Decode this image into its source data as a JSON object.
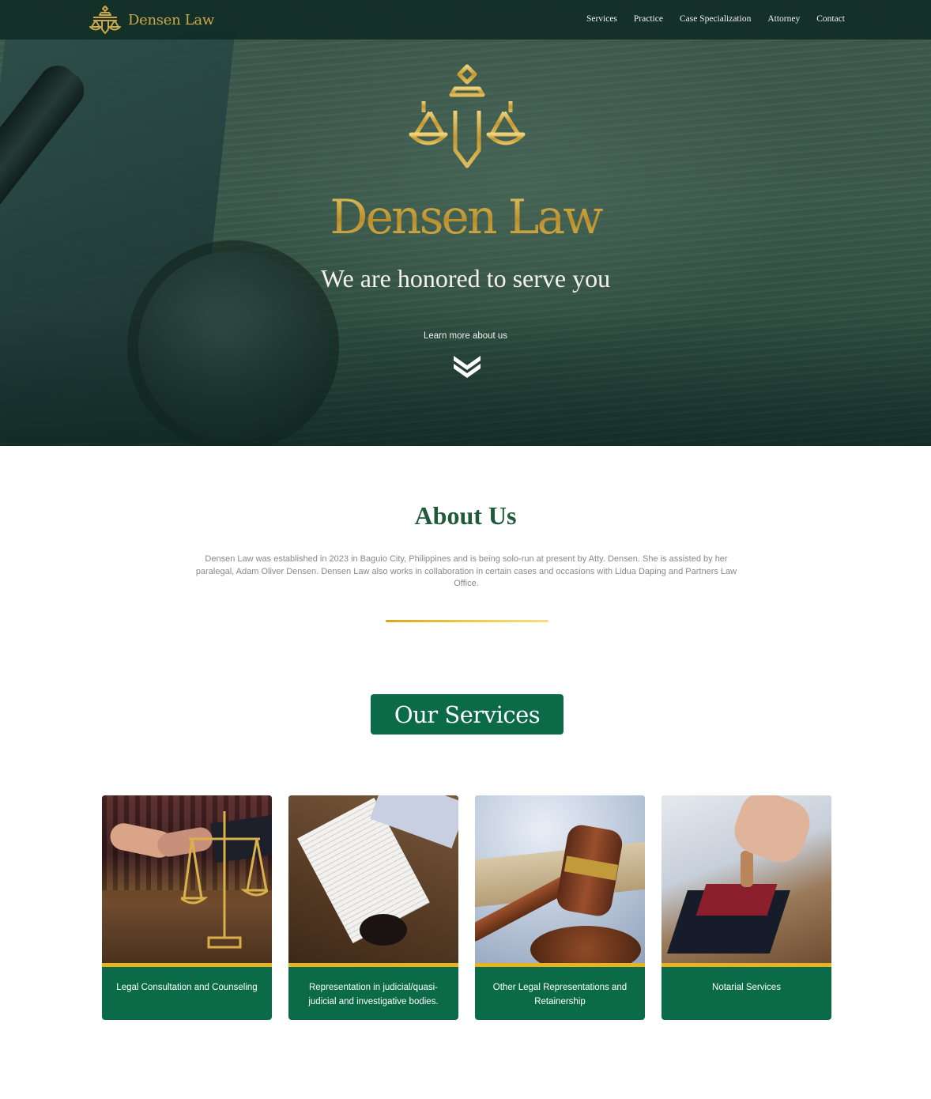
{
  "nav": {
    "brand": "Densen Law",
    "links": [
      "Services",
      "Practice",
      "Case Specialization",
      "Attorney",
      "Contact"
    ]
  },
  "hero": {
    "title": "Densen Law",
    "tagline": "We are honored to serve you",
    "learn_more": "Learn more about us"
  },
  "about": {
    "title": "About Us",
    "text": "Densen Law was established in 2023 in Baguio City, Philippines and is being solo-run at present by Atty. Densen. She is assisted by her paralegal, Adam Oliver Densen. Densen Law also works in collaboration in certain cases and occasions with Lidua Daping and Partners Law Office."
  },
  "services": {
    "title": "Our Services",
    "cards": [
      {
        "label": "Legal Consultation and Counseling"
      },
      {
        "label": "Representation in judicial/quasi-judicial and investigative bodies."
      },
      {
        "label": "Other Legal Representations and Retainership"
      },
      {
        "label": "Notarial Services"
      }
    ]
  },
  "colors": {
    "brand_green": "#0b6b49",
    "gold": "#d1ac45",
    "nav_bg": "#102c26"
  }
}
